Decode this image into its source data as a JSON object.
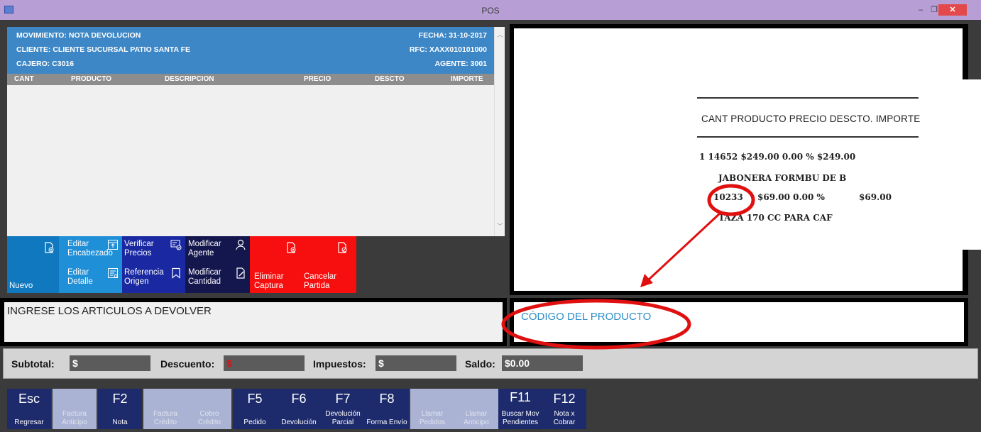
{
  "window": {
    "title": "POS",
    "minimize": "–",
    "restore": "❐",
    "close": "✕"
  },
  "header": {
    "movimiento": "MOVIMIENTO: NOTA DEVOLUCION",
    "fecha": "FECHA: 31-10-2017",
    "cliente": "CLIENTE: CLIENTE SUCURSAL PATIO SANTA FE",
    "rfc": "RFC: XAXX010101000",
    "cajero": "CAJERO: C3016",
    "agente": "AGENTE: 3001"
  },
  "columns": [
    "CANT",
    "PRODUCTO",
    "DESCRIPCION",
    "PRECIO",
    "DESCTO",
    "IMPORTE"
  ],
  "actions": {
    "nuevo": "Nuevo",
    "editar_encabezado": [
      "Editar",
      "Encabezado"
    ],
    "editar_detalle": [
      "Editar",
      "Detalle"
    ],
    "verificar_precios": [
      "Verificar",
      "Precios"
    ],
    "referencia_origen": [
      "Referencia",
      "Origen"
    ],
    "modificar_agente": [
      "Modificar",
      "Agente"
    ],
    "modificar_cantidad": [
      "Modificar",
      "Cantidad"
    ],
    "eliminar_captura": [
      "Eliminar",
      "Captura"
    ],
    "cancelar_partida": [
      "Cancelar",
      "Partida"
    ]
  },
  "receipt": {
    "header": "CANT  PRODUCTO    PRECIO DESCTO. IMPORTE",
    "lines": [
      "1 14652     $249.00  0.00 %      $249.00",
      "JABONERA FORMBU DE B",
      "10233",
      "$69.00  0.00 %",
      "$69.00",
      "TAZA 170 CC PARA CAF"
    ]
  },
  "messages": {
    "left": "INGRESE LOS ARTICULOS A DEVOLVER",
    "right": "CÓDIGO DEL PRODUCTO"
  },
  "totals": {
    "subtotal_label": "Subtotal:",
    "subtotal_value": "$",
    "descuento_label": "Descuento:",
    "descuento_value": "$",
    "impuestos_label": "Impuestos:",
    "impuestos_value": "$",
    "saldo_label": "Saldo:",
    "saldo_value": "$0.00"
  },
  "function_keys": [
    {
      "key": "Esc",
      "desc": "Regresar",
      "enabled": true
    },
    {
      "key": "",
      "desc": "Factura Anticipo",
      "enabled": false
    },
    {
      "key": "F2",
      "desc": "Nota",
      "enabled": true
    },
    {
      "key": "",
      "desc": "Factura Crédito",
      "enabled": false
    },
    {
      "key": "",
      "desc": "Cobro Crédito",
      "enabled": false
    },
    {
      "key": "F5",
      "desc": "Pedido",
      "enabled": true
    },
    {
      "key": "F6",
      "desc": "Devolución",
      "enabled": true
    },
    {
      "key": "F7",
      "desc": "Devolución Parcial",
      "enabled": true
    },
    {
      "key": "F8",
      "desc": "Forma Envío",
      "enabled": true
    },
    {
      "key": "",
      "desc": "Llamar Pedidos",
      "enabled": false
    },
    {
      "key": "",
      "desc": "Llamar Anticipo",
      "enabled": false
    },
    {
      "key": "F11",
      "desc": "Buscar Mov Pendientes",
      "enabled": true
    },
    {
      "key": "F12",
      "desc": "Nota x Cobrar",
      "enabled": true
    }
  ],
  "colors": {
    "header_blue": "#3e87c6",
    "danger_red": "#f70f0f",
    "fkey_navy": "#1d2a6b",
    "annotation_red": "#e01010",
    "info_blue": "#2e8fc8"
  },
  "icons": {
    "nuevo": "document-add-icon",
    "editar_encabezado": "header-edit-icon",
    "editar_detalle": "detail-edit-icon",
    "verificar_precios": "price-check-icon",
    "referencia_origen": "bookmark-icon",
    "modificar_agente": "person-icon",
    "modificar_cantidad": "edit-document-icon",
    "eliminar_captura": "document-delete-icon",
    "cancelar_partida": "document-cancel-icon"
  }
}
